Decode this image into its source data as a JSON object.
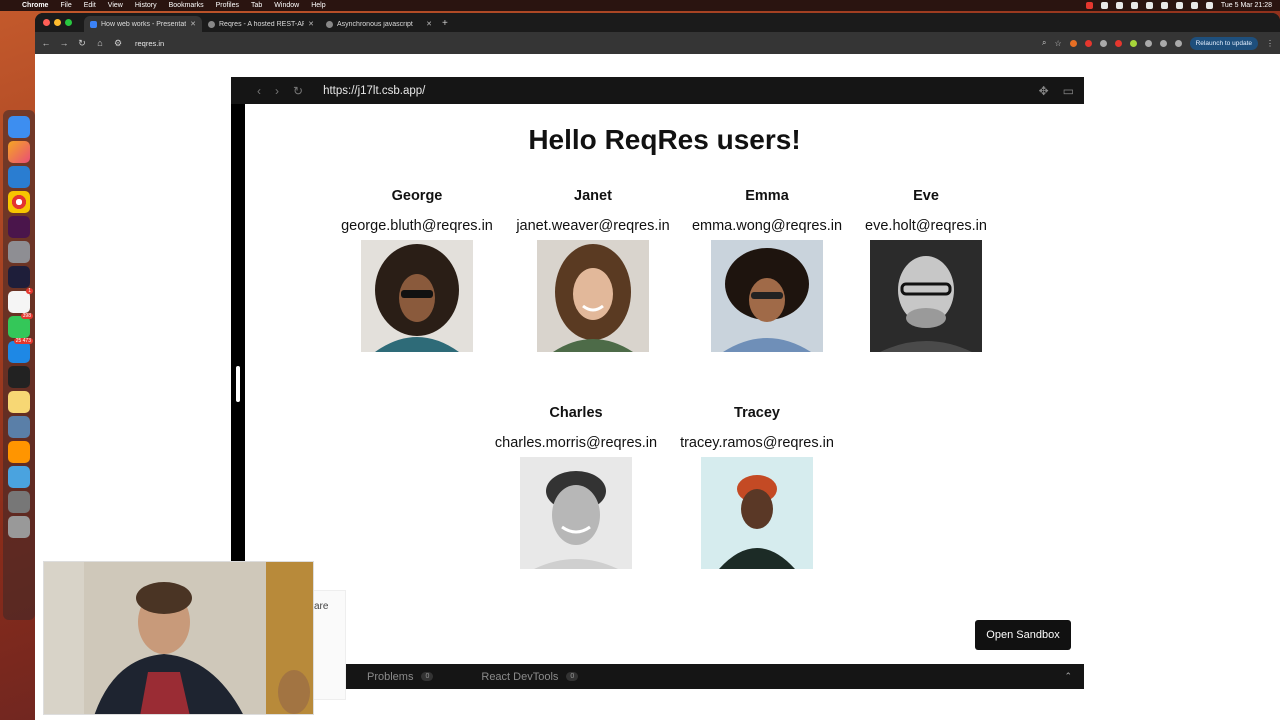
{
  "menubar": {
    "app": "Chrome",
    "menus": [
      "File",
      "Edit",
      "View",
      "History",
      "Bookmarks",
      "Profiles",
      "Tab",
      "Window",
      "Help"
    ],
    "clock": "Tue 5 Mar  21:28"
  },
  "dock": {
    "badges": {
      "calendar": "1",
      "messages": "398",
      "mail": "25 473"
    }
  },
  "browser": {
    "tabs": [
      {
        "title": "How web works - Presentation"
      },
      {
        "title": "Reqres - A hosted REST-API"
      },
      {
        "title": "Asynchronous javascript"
      }
    ],
    "address": "reqres.in",
    "relaunch_label": "Relaunch to update"
  },
  "sandbox": {
    "url": "https://j17lt.csb.app/",
    "heading": "Hello ReqRes users!",
    "users": [
      {
        "first_name": "George",
        "email": "george.bluth@reqres.in"
      },
      {
        "first_name": "Janet",
        "email": "janet.weaver@reqres.in"
      },
      {
        "first_name": "Emma",
        "email": "emma.wong@reqres.in"
      },
      {
        "first_name": "Eve",
        "email": "eve.holt@reqres.in"
      },
      {
        "first_name": "Charles",
        "email": "charles.morris@reqres.in"
      },
      {
        "first_name": "Tracey",
        "email": "tracey.ramos@reqres.in"
      }
    ],
    "open_sandbox_label": "Open Sandbox",
    "bottom_tabs": [
      {
        "label": "Problems",
        "count": "0"
      },
      {
        "label": "React DevTools",
        "count": "0"
      }
    ]
  },
  "peek_text": "are",
  "colors": {
    "page_bg": "#ffffff",
    "sandbox_chrome": "#151515",
    "relaunch_bg": "#1e4f7c"
  }
}
